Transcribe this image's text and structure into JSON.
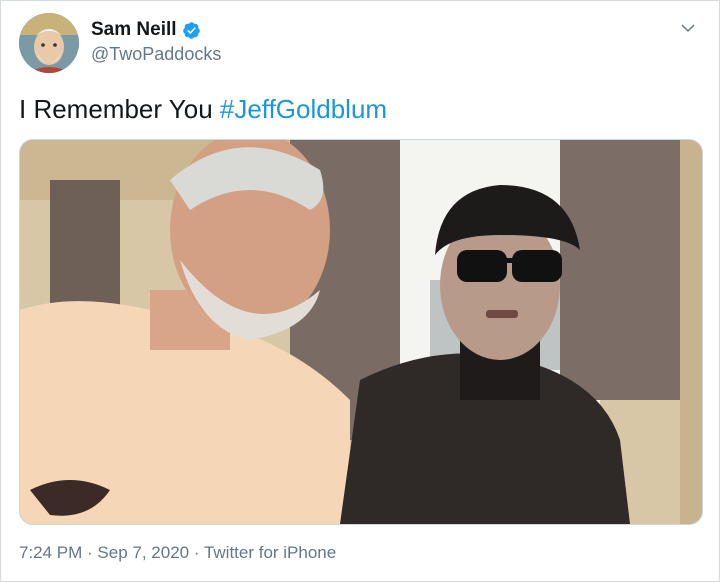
{
  "author": {
    "display_name": "Sam Neill",
    "handle": "@TwoPaddocks",
    "verified": true,
    "avatar_icon": "avatar-illustration"
  },
  "tweet": {
    "text": "I Remember You ",
    "hashtag": "#JeffGoldblum",
    "hashtag_color": "#1b95e0"
  },
  "media": {
    "type": "video-still",
    "description_icon": "video-frame"
  },
  "meta": {
    "time": "7:24 PM",
    "separator": " · ",
    "date": "Sep 7, 2020",
    "source": "Twitter for iPhone"
  },
  "colors": {
    "text": "#14171a",
    "secondary": "#657786",
    "verified": "#1da1f2",
    "border": "#d6dbe0"
  }
}
